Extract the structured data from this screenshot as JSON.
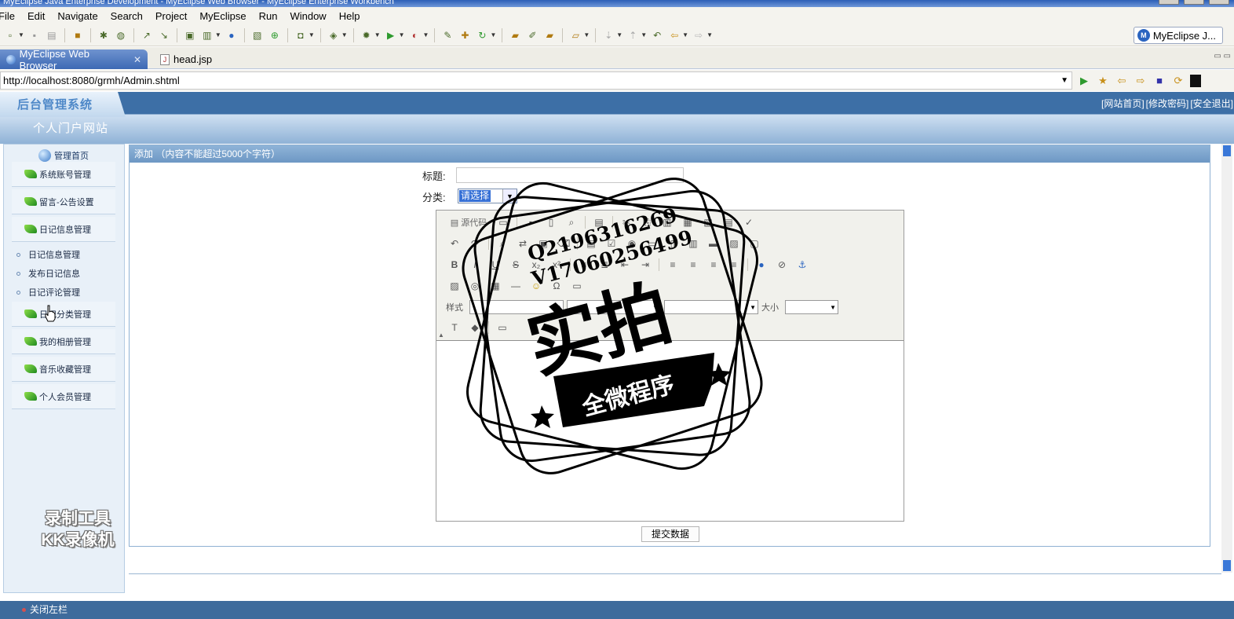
{
  "window": {
    "title": "MyEclipse Java Enterprise Development - MyEclipse Web Browser - MyEclipse Enterprise Workbench"
  },
  "menu": [
    "File",
    "Edit",
    "Navigate",
    "Search",
    "Project",
    "MyEclipse",
    "Run",
    "Window",
    "Help"
  ],
  "perspective": {
    "label": "MyEclipse J..."
  },
  "tabs": [
    {
      "label": "MyEclipse Web Browser",
      "active": true
    },
    {
      "label": "head.jsp",
      "active": false
    }
  ],
  "browser": {
    "url": "http://localhost:8080/grmh/Admin.shtml"
  },
  "site": {
    "brand": "后台管理系统",
    "name": "个人门户网站",
    "top_links": [
      "[网站首页]",
      "[修改密码]",
      "[安全退出]"
    ]
  },
  "sidebar": {
    "home": "管理首页",
    "items": [
      {
        "label": "系统账号管理"
      },
      {
        "label": "留言-公告设置"
      },
      {
        "label": "日记信息管理"
      }
    ],
    "subitems": [
      {
        "label": "日记信息管理"
      },
      {
        "label": "发布日记信息"
      },
      {
        "label": "日记评论管理"
      }
    ],
    "items2": [
      {
        "label": "日记分类管理"
      },
      {
        "label": "我的相册管理"
      },
      {
        "label": "音乐收藏管理"
      },
      {
        "label": "个人会员管理"
      }
    ],
    "close": "关闭左栏"
  },
  "panel": {
    "title": "添加 （内容不能超过5000个字符）",
    "title_label": "标题:",
    "title_value": "",
    "category_label": "分类:",
    "category_value": "请选择",
    "submit": "提交数据"
  },
  "editor": {
    "source_label": "源代码",
    "style_label": "样式",
    "size_label": "大小"
  },
  "stamp": {
    "line1": "Q2196316269",
    "line2": "V17060256499",
    "big": "实拍",
    "banner": "全微程序"
  },
  "recorder_watermark": [
    "录制工具",
    "KK录像机"
  ]
}
